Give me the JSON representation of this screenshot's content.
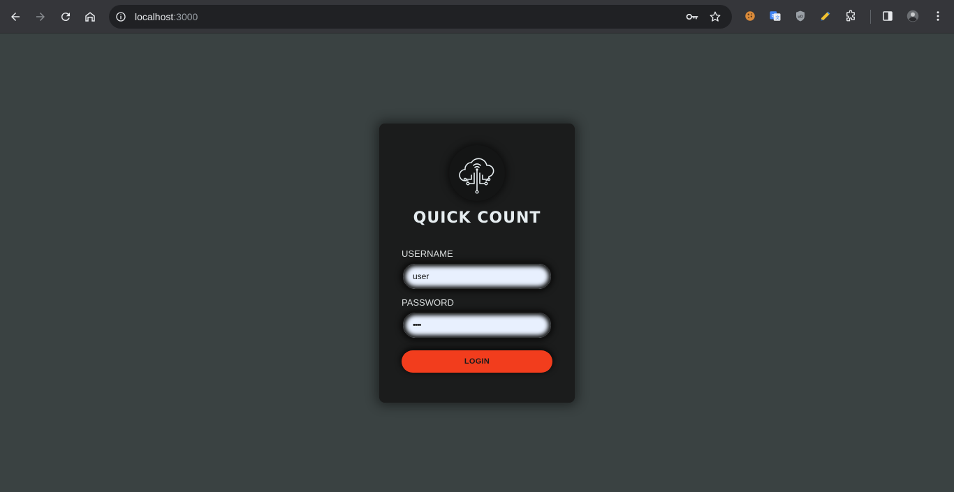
{
  "browser": {
    "url_host": "localhost",
    "url_port": ":3000",
    "icons": {
      "back": "arrow-left-icon",
      "forward": "arrow-right-icon",
      "reload": "reload-icon",
      "home": "home-icon",
      "site_info": "info-icon",
      "password": "key-icon",
      "bookmark": "star-icon",
      "extensions": [
        "cookie-icon",
        "translate-icon",
        "ublock-icon",
        "highlighter-icon",
        "puzzle-icon"
      ],
      "side_panel": "side-panel-icon",
      "profile": "avatar",
      "menu": "kebab-menu-icon"
    }
  },
  "login": {
    "title": "QUICK COUNT",
    "logo": "cloud-circuit-logo",
    "username_label": "USERNAME",
    "username_value": "user",
    "password_label": "PASSWORD",
    "password_value": "••••",
    "button_label": "LOGIN"
  },
  "colors": {
    "page_bg": "#3a4242",
    "card_bg": "#1b1c1c",
    "accent": "#f23d1d",
    "input_bg": "#e8f0fe"
  }
}
